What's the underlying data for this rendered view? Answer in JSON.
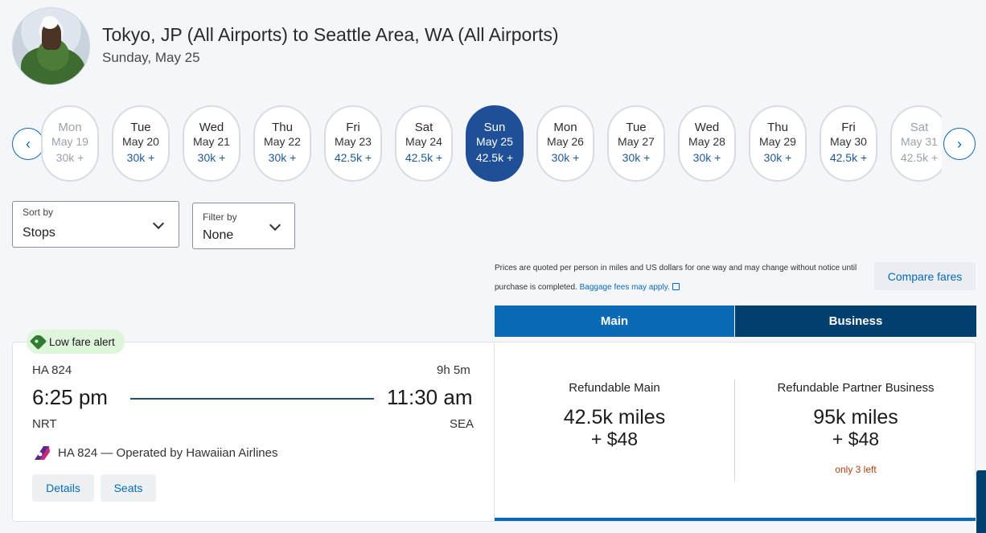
{
  "header": {
    "title": "Tokyo, JP (All Airports) to Seattle Area, WA (All Airports)",
    "date": "Sunday, May 25"
  },
  "date_strip": {
    "items": [
      {
        "day": "Mon",
        "date": "May 19",
        "price": "30k +",
        "state": "faded"
      },
      {
        "day": "Tue",
        "date": "May 20",
        "price": "30k +",
        "state": "normal"
      },
      {
        "day": "Wed",
        "date": "May 21",
        "price": "30k +",
        "state": "normal"
      },
      {
        "day": "Thu",
        "date": "May 22",
        "price": "30k +",
        "state": "normal"
      },
      {
        "day": "Fri",
        "date": "May 23",
        "price": "42.5k +",
        "state": "normal"
      },
      {
        "day": "Sat",
        "date": "May 24",
        "price": "42.5k +",
        "state": "normal"
      },
      {
        "day": "Sun",
        "date": "May 25",
        "price": "42.5k +",
        "state": "selected"
      },
      {
        "day": "Mon",
        "date": "May 26",
        "price": "30k +",
        "state": "normal"
      },
      {
        "day": "Tue",
        "date": "May 27",
        "price": "30k +",
        "state": "normal"
      },
      {
        "day": "Wed",
        "date": "May 28",
        "price": "30k +",
        "state": "normal"
      },
      {
        "day": "Thu",
        "date": "May 29",
        "price": "30k +",
        "state": "normal"
      },
      {
        "day": "Fri",
        "date": "May 30",
        "price": "42.5k +",
        "state": "normal"
      },
      {
        "day": "Sat",
        "date": "May 31",
        "price": "42.5k +",
        "state": "faded"
      }
    ]
  },
  "sort": {
    "label": "Sort by",
    "value": "Stops"
  },
  "filter": {
    "label": "Filter by",
    "value": "None"
  },
  "notice": {
    "text": "Prices are quoted per person in miles and US dollars for one way and may change without notice until purchase is completed.",
    "link": "Baggage fees may apply."
  },
  "compare_label": "Compare fares",
  "fare_tabs": {
    "main": "Main",
    "business": "Business"
  },
  "flight": {
    "badge": "Low fare alert",
    "number": "HA 824",
    "duration": "9h 5m",
    "depart_time": "6:25 pm",
    "arrive_time": "11:30 am",
    "depart_code": "NRT",
    "arrive_code": "SEA",
    "operated": "HA 824 — Operated by Hawaiian Airlines",
    "details_label": "Details",
    "seats_label": "Seats"
  },
  "fares": {
    "main": {
      "name": "Refundable Main",
      "miles": "42.5k miles",
      "tax": "+ $48"
    },
    "business": {
      "name": "Refundable Partner Business",
      "miles": "95k miles",
      "tax": "+ $48",
      "availability": "only 3 left"
    }
  },
  "colors": {
    "accent": "#0a6ab5",
    "selected": "#1f4f97",
    "business": "#003f6e",
    "badge_bg": "#dff5dc",
    "warning": "#b0410e"
  }
}
